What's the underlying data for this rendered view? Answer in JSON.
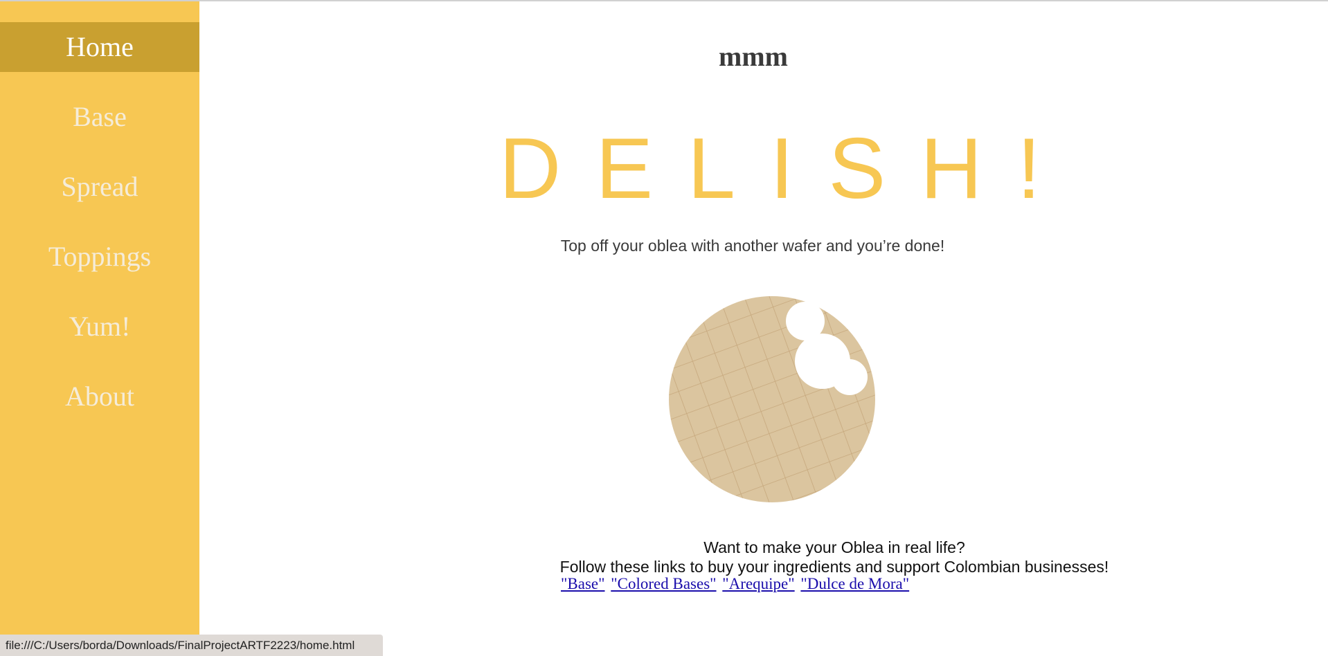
{
  "sidebar": {
    "items": [
      {
        "label": "Home",
        "active": true
      },
      {
        "label": "Base"
      },
      {
        "label": "Spread"
      },
      {
        "label": "Toppings"
      },
      {
        "label": "Yum!"
      },
      {
        "label": "About"
      }
    ]
  },
  "main": {
    "brand": "mmm",
    "headline": "DELISH!",
    "subline": "Top off your oblea with another wafer and you’re done!",
    "cta_line1": "Want to make your Oblea in real life?",
    "cta_line2": "Follow these links to buy your ingredients and support Colombian businesses!",
    "links": [
      "\"Base\"",
      "\"Colored Bases\"",
      "\"Arequipe\"",
      "\"Dulce de Mora\""
    ]
  },
  "status_bar": {
    "url": "file:///C:/Users/borda/Downloads/FinalProjectARTF2223/home.html"
  },
  "colors": {
    "sidebar": "#f7c753",
    "sidebar_active": "#c9a030",
    "headline": "#f7c753",
    "wafer": "#dbc59f",
    "wafer_grid": "#c6a77c"
  },
  "icons": {
    "wafer": "oblea-wafer-bitten-icon"
  }
}
